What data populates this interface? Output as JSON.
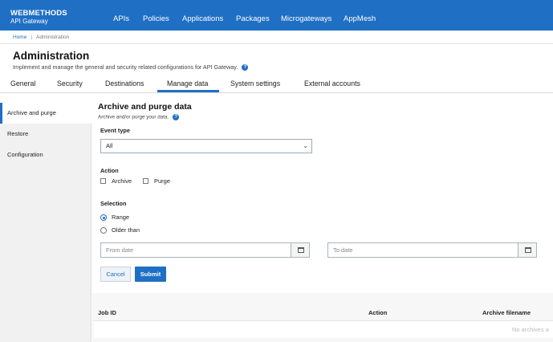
{
  "brand": {
    "line1": "WEBMETHODS",
    "line2": "API Gateway"
  },
  "nav": [
    "APIs",
    "Policies",
    "Applications",
    "Packages",
    "Microgateways",
    "AppMesh"
  ],
  "breadcrumb": {
    "home": "Home",
    "separator": "|",
    "current": "Administration"
  },
  "page": {
    "title": "Administration",
    "subtitle": "Implement and manage the general and security related configurations for API Gateway."
  },
  "tabs": [
    "General",
    "Security",
    "Destinations",
    "Manage data",
    "System settings",
    "External accounts"
  ],
  "active_tab": "Manage data",
  "sidebar": [
    "Archive and purge",
    "Restore",
    "Configuration"
  ],
  "main": {
    "title": "Archive and purge data",
    "subtitle": "Archive and/or purge your data."
  },
  "form": {
    "event_type_label": "Event type",
    "event_type_value": "All",
    "action_label": "Action",
    "archive_label": "Archive",
    "purge_label": "Purge",
    "archive_checked": false,
    "purge_checked": false,
    "selection_label": "Selection",
    "range_label": "Range",
    "older_than_label": "Older than",
    "selected_option": "Range",
    "from_date_placeholder": "From date",
    "to_date_placeholder": "To date",
    "cancel_label": "Cancel",
    "submit_label": "Submit"
  },
  "table": {
    "columns": [
      "Job ID",
      "Action",
      "Archive filename"
    ],
    "empty_text": "No archives a"
  },
  "colors": {
    "accent": "#1f6fc4",
    "topbar": "#1f6fc4",
    "sidebar_bg": "#f1f1f1"
  },
  "icons": [
    "help-icon",
    "chevron-down-icon",
    "calendar-icon"
  ]
}
